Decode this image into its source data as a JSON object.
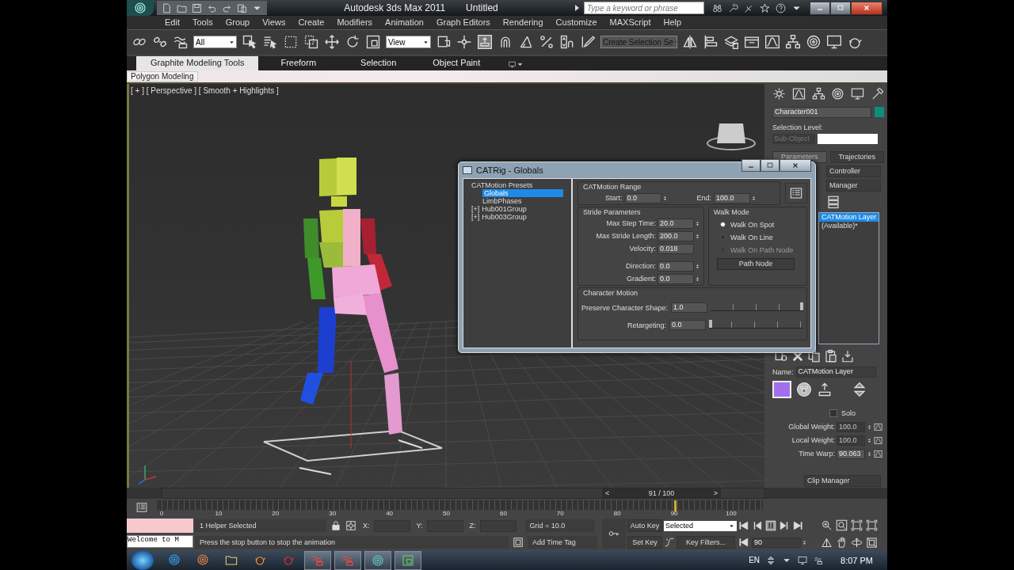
{
  "title_bar": {
    "app_title": "Autodesk 3ds Max 2011",
    "file_name": "Untitled",
    "search": {
      "placeholder": "Type a keyword or phrase"
    }
  },
  "menu": [
    "Edit",
    "Tools",
    "Group",
    "Views",
    "Create",
    "Modifiers",
    "Animation",
    "Graph Editors",
    "Rendering",
    "Customize",
    "MAXScript",
    "Help"
  ],
  "main_toolbar": {
    "selection_filter": "All",
    "reference_coordinate": "View",
    "named_selection": "Create Selection Se"
  },
  "ribbon": {
    "tabs": [
      {
        "label": "Graphite Modeling Tools",
        "selected": true
      },
      {
        "label": "Freeform",
        "selected": false
      },
      {
        "label": "Selection",
        "selected": false
      },
      {
        "label": "Object Paint",
        "selected": false
      }
    ],
    "panel_label": "Polygon Modeling"
  },
  "viewport": {
    "label": "[ + ] [ Perspective ] [ Smooth + Highlights ]"
  },
  "dialog": {
    "title": "CATRig - Globals",
    "tree": [
      {
        "label": "CATMotion Presets",
        "selected": false,
        "children": [
          {
            "label": "Globals",
            "selected": true
          },
          {
            "label": "LimbPhases",
            "selected": false
          }
        ]
      },
      {
        "label": "Hub001Group",
        "expander": "[+]",
        "selected": false
      },
      {
        "label": "Hub003Group",
        "expander": "[+]",
        "selected": false
      }
    ],
    "range": {
      "title": "CATMotion Range",
      "start_label": "Start:",
      "start": "0.0",
      "end_label": "End:",
      "end": "100.0"
    },
    "stride": {
      "title": "Stride Parameters",
      "fields": [
        {
          "label": "Max Step Time:",
          "value": "20.0",
          "spinner": true
        },
        {
          "label": "Max Stride Length:",
          "value": "200.0",
          "spinner": true
        },
        {
          "label": "Velocity:",
          "value": "0.018",
          "spinner": false
        },
        {
          "label": "Direction:",
          "value": "0.0",
          "spinner": true
        },
        {
          "label": "Gradient:",
          "value": "0.0",
          "spinner": true
        }
      ]
    },
    "walk_mode": {
      "title": "Walk Mode",
      "options": [
        {
          "label": "Walk On Spot",
          "selected": true,
          "disabled": false
        },
        {
          "label": "Walk On Line",
          "selected": false,
          "disabled": false
        },
        {
          "label": "Walk On Path Node",
          "selected": false,
          "disabled": true
        }
      ],
      "button": "Path Node"
    },
    "character_motion": {
      "title": "Character Motion",
      "sliders": [
        {
          "label": "Preserve Character Shape:",
          "value": "1.0",
          "level": 1.0
        },
        {
          "label": "Retargeting:",
          "value": "0.0",
          "level": 0.0
        }
      ]
    }
  },
  "command_panel": {
    "object_name": "Character001",
    "selection_level_label": "Selection Level:",
    "sub_object": "Sub-Object",
    "tabs": [
      {
        "label": "Parameters",
        "selected": true
      },
      {
        "label": "Trajectories",
        "selected": false
      }
    ],
    "rollouts": [
      "Controller",
      "Manager"
    ],
    "layers": [
      {
        "label": "CATMotion Layer",
        "selected": true
      },
      {
        "label": "(Available)*",
        "selected": false
      }
    ],
    "name_label": "Name:",
    "layer_name": "CATMotion Layer",
    "solo": {
      "label": "Solo",
      "checked": false
    },
    "weights": [
      {
        "label": "Global Weight:",
        "value": "100.0",
        "disabled": true
      },
      {
        "label": "Local Weight:",
        "value": "100.0",
        "disabled": true
      },
      {
        "label": "Time Warp:",
        "value": "90.063",
        "disabled": false
      }
    ],
    "clip_manager": "Clip Manager"
  },
  "time_slider": {
    "prev": "<",
    "frame": "91 / 100",
    "next": ">",
    "level": 0.91
  },
  "ruler": {
    "ticks": [
      "0",
      "10",
      "20",
      "30",
      "40",
      "50",
      "60",
      "70",
      "80",
      "90",
      "100"
    ],
    "level": 0.9
  },
  "status": {
    "maxscript_output": "Welcome to M",
    "selection": "1 Helper Selected",
    "x_label": "X:",
    "y_label": "Y:",
    "z_label": "Z:",
    "grid": "Grid = 10.0",
    "prompt": "Press the stop button to stop the animation",
    "time_tag": "Add Time Tag",
    "auto_key": "Auto Key",
    "key_mode": "Selected",
    "set_key": "Set Key",
    "key_filters": "Key Filters...",
    "current_frame": "90"
  },
  "taskbar": {
    "language": "EN",
    "clock": "8:07 PM"
  }
}
